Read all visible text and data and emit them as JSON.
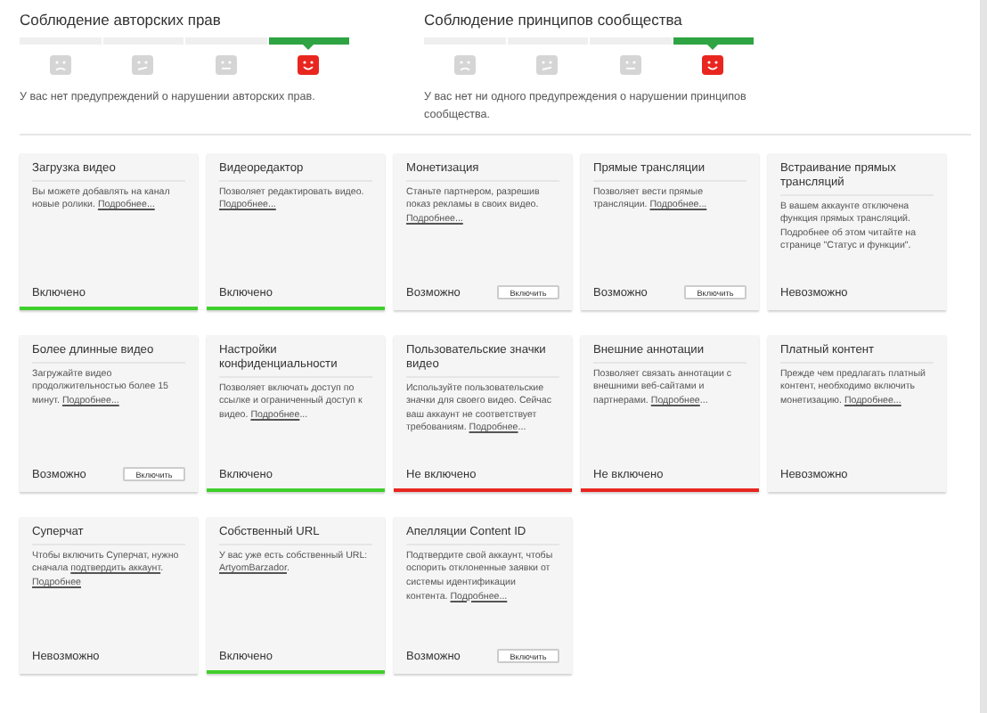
{
  "strikes": [
    {
      "title": "Соблюдение авторских прав",
      "steps": [
        {
          "kind": "sad",
          "selected": false
        },
        {
          "kind": "meh",
          "selected": false
        },
        {
          "kind": "neutral",
          "selected": false
        },
        {
          "kind": "happy",
          "selected": true
        }
      ],
      "message": "У вас нет предупреждений о нарушении авторских прав."
    },
    {
      "title": "Соблюдение принципов сообщества",
      "steps": [
        {
          "kind": "sad",
          "selected": false
        },
        {
          "kind": "meh",
          "selected": false
        },
        {
          "kind": "neutral",
          "selected": false
        },
        {
          "kind": "happy",
          "selected": true
        }
      ],
      "message": "У вас нет ни одного предупреждения о нарушении принципов сообщества."
    }
  ],
  "features": [
    {
      "title": "Загрузка видео",
      "description": [
        {
          "text": "Вы можете добавлять на канал новые ролики. ",
          "link": false
        },
        {
          "text": "Подробнее...",
          "link": true
        }
      ],
      "status": "Включено",
      "kind": "enabled"
    },
    {
      "title": "Видеоредактор",
      "description": [
        {
          "text": "Позволяет редактировать видео. ",
          "link": false
        },
        {
          "text": "Подробнее...",
          "link": true
        }
      ],
      "status": "Включено",
      "kind": "enabled"
    },
    {
      "title": "Монетизация",
      "description": [
        {
          "text": "Станьте партнером, разрешив показ рекламы в своих видео. ",
          "link": false
        },
        {
          "text": "Подробнее...",
          "link": true
        }
      ],
      "status": "Возможно",
      "kind": "available",
      "button": "Включить"
    },
    {
      "title": "Прямые трансляции",
      "description": [
        {
          "text": "Позволяет вести прямые трансляции. ",
          "link": false
        },
        {
          "text": "Подробнее...",
          "link": true
        }
      ],
      "status": "Возможно",
      "kind": "available",
      "button": "Включить"
    },
    {
      "title": "Встраивание прямых трансляций",
      "description": [
        {
          "text": "В вашем аккаунте отключена функция прямых трансляций. Подробнее об этом читайте на странице \"Статус и функции\".",
          "link": false
        }
      ],
      "status": "Невозможно",
      "kind": "unavailable"
    },
    {
      "title": "Более длинные видео",
      "description": [
        {
          "text": "Загружайте видео продолжительностью более 15 минут. ",
          "link": false
        },
        {
          "text": "Подробнее...",
          "link": true
        }
      ],
      "status": "Возможно",
      "kind": "available",
      "button": "Включить"
    },
    {
      "title": "Настройки конфиденциальности",
      "description": [
        {
          "text": "Позволяет включать доступ по ссылке и ограниченный доступ к видео. ",
          "link": false
        },
        {
          "text": "Подробнее",
          "link": true
        },
        {
          "text": "...",
          "link": false
        }
      ],
      "status": "Включено",
      "kind": "enabled"
    },
    {
      "title": "Пользовательские значки видео",
      "description": [
        {
          "text": "Используйте пользовательские значки для своего видео. Сейчас ваш аккаунт не соответствует требованиям. ",
          "link": false
        },
        {
          "text": "Подробнее",
          "link": true
        },
        {
          "text": "...",
          "link": false
        }
      ],
      "status": "Не включено",
      "kind": "disabled"
    },
    {
      "title": "Внешние аннотации",
      "description": [
        {
          "text": "Позволяет связать аннотации с внешними веб-сайтами и партнерами. ",
          "link": false
        },
        {
          "text": "Подробнее",
          "link": true
        },
        {
          "text": "...",
          "link": false
        }
      ],
      "status": "Не включено",
      "kind": "disabled"
    },
    {
      "title": "Платный контент",
      "description": [
        {
          "text": "Прежде чем предлагать платный контент, необходимо включить монетизацию. ",
          "link": false
        },
        {
          "text": "Подробнее...",
          "link": true
        }
      ],
      "status": "Невозможно",
      "kind": "unavailable"
    },
    {
      "title": "Суперчат",
      "description": [
        {
          "text": "Чтобы включить Суперчат, нужно сначала ",
          "link": false
        },
        {
          "text": "подтвердить аккаунт",
          "link": true
        },
        {
          "text": ". ",
          "link": false
        },
        {
          "text": "Подробнее",
          "link": true
        }
      ],
      "status": "Невозможно",
      "kind": "unavailable"
    },
    {
      "title": "Собственный URL",
      "description": [
        {
          "text": "У вас уже есть собственный URL: ",
          "link": false
        },
        {
          "text": "ArtyomBarzador",
          "link": true
        },
        {
          "text": ".",
          "link": false
        }
      ],
      "status": "Включено",
      "kind": "enabled"
    },
    {
      "title": "Апелляции Content ID",
      "description": [
        {
          "text": "Подтвердите свой аккаунт, чтобы оспорить отклоненные заявки от системы идентификации контента. ",
          "link": false
        },
        {
          "text": "Подробнее...",
          "link": true
        }
      ],
      "status": "Возможно",
      "kind": "available",
      "button": "Включить"
    }
  ]
}
